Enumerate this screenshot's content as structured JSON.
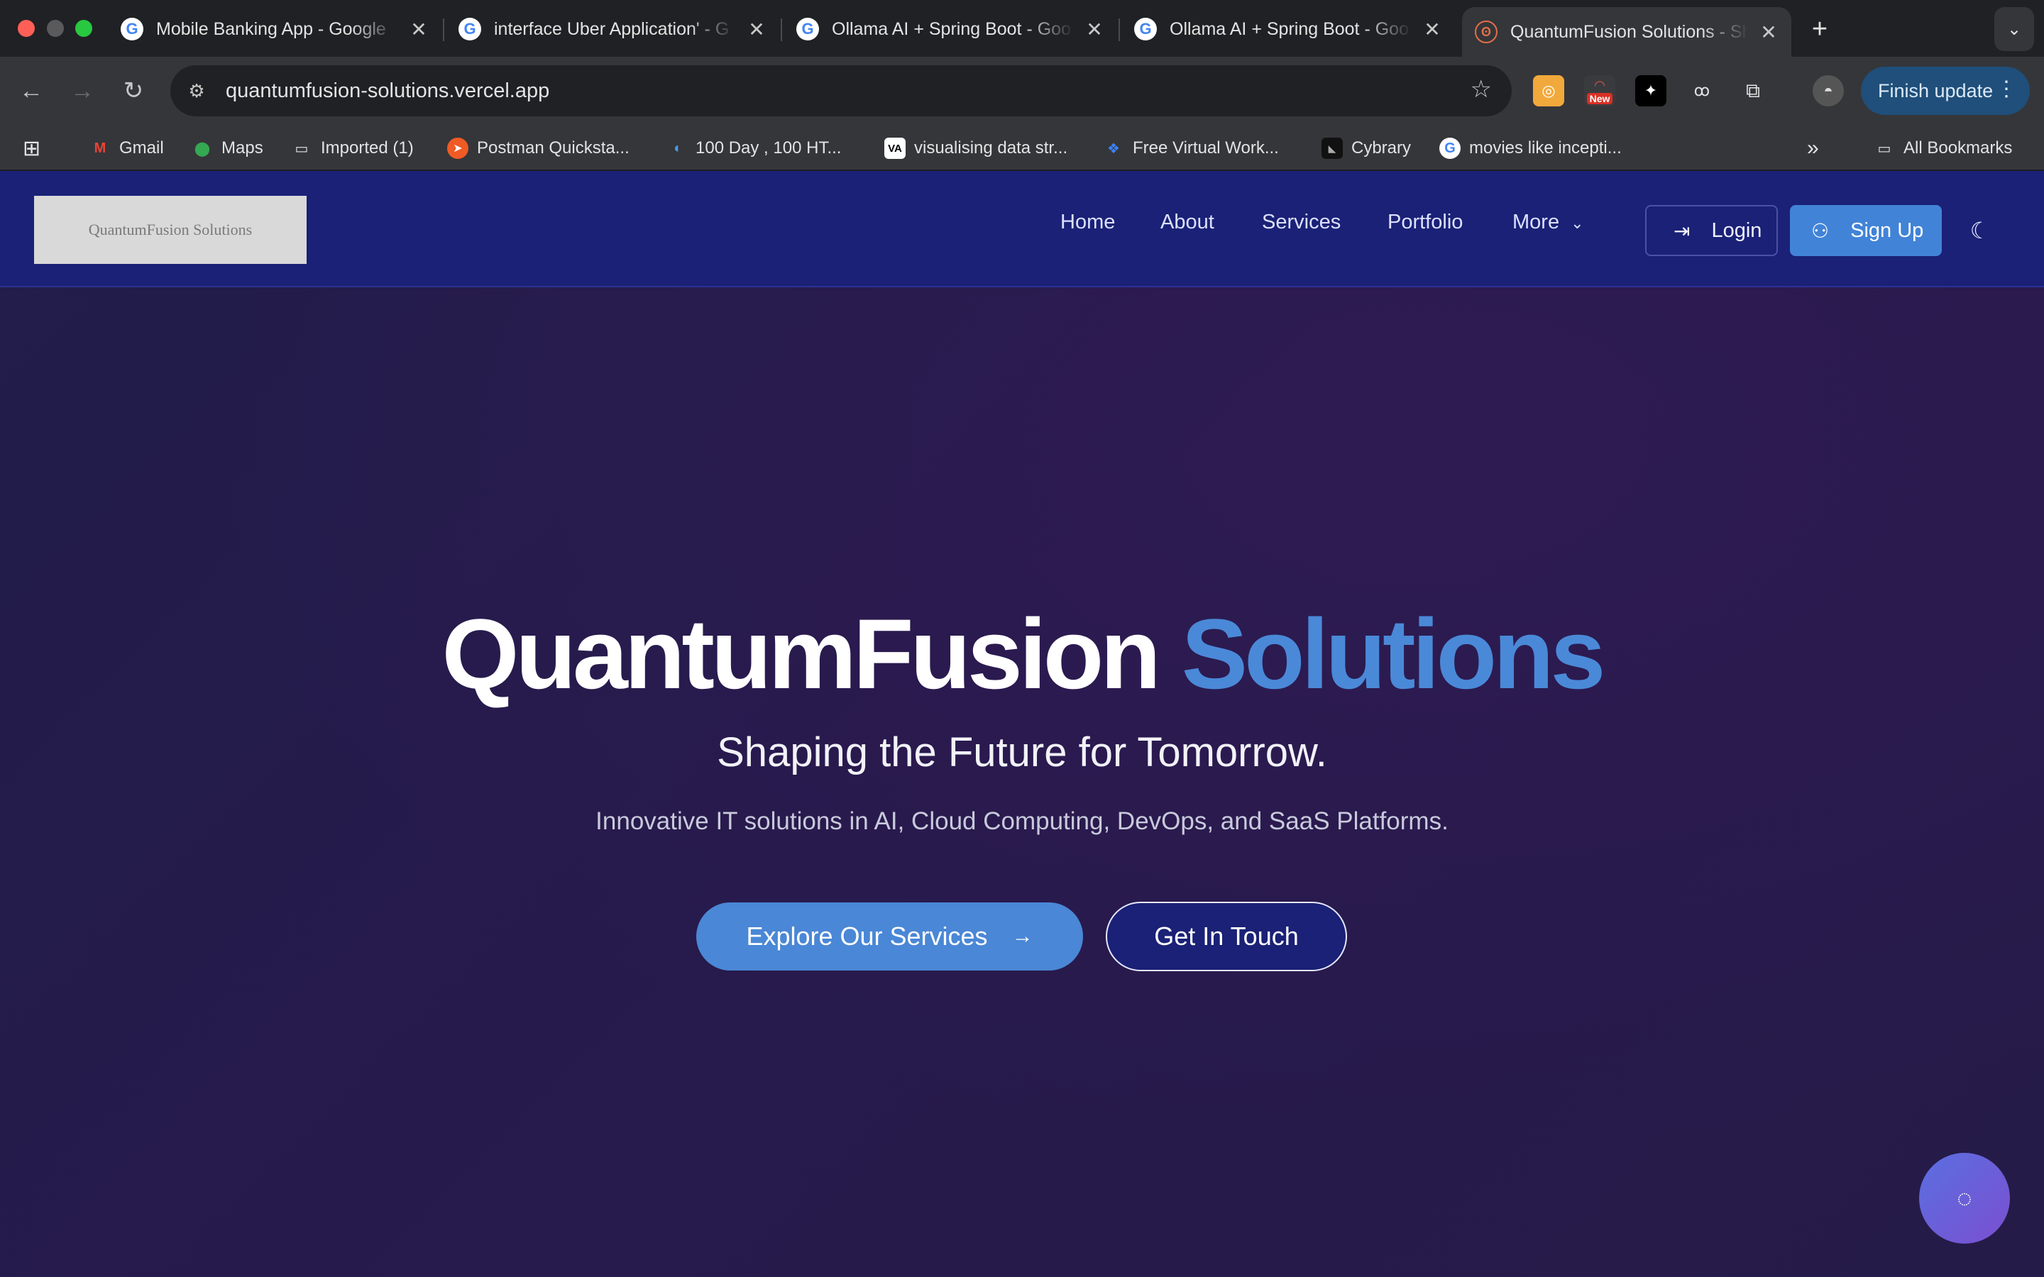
{
  "browser": {
    "tabs": [
      {
        "title": "Mobile Banking App - Google",
        "favicon": "google-icon"
      },
      {
        "title": "interface Uber Application' - G",
        "favicon": "google-icon"
      },
      {
        "title": "Ollama AI + Spring Boot - Goo",
        "favicon": "google-icon"
      },
      {
        "title": "Ollama AI + Spring Boot - Goo",
        "favicon": "google-icon"
      },
      {
        "title": "QuantumFusion Solutions - Sh",
        "favicon": "site-icon"
      }
    ],
    "new_tab_label": "+",
    "url": "quantumfusion-solutions.vercel.app",
    "ext_new_badge": "New",
    "finish_update_label": "Finish update",
    "bookmarks": [
      {
        "label": "Gmail",
        "icon": "gmail-icon"
      },
      {
        "label": "Maps",
        "icon": "maps-icon"
      },
      {
        "label": "Imported (1)",
        "icon": "folder-icon"
      },
      {
        "label": "Postman Quicksta...",
        "icon": "postman-icon"
      },
      {
        "label": "100 Day , 100 HT...",
        "icon": "headphones-icon"
      },
      {
        "label": "visualising data str...",
        "icon": "va-icon"
      },
      {
        "label": "Free Virtual Work...",
        "icon": "forage-icon"
      },
      {
        "label": "Cybrary",
        "icon": "cybrary-icon"
      },
      {
        "label": "movies like incepti...",
        "icon": "google-icon"
      }
    ],
    "all_bookmarks_label": "All Bookmarks"
  },
  "site": {
    "logo_text": "QuantumFusion Solutions",
    "nav": {
      "home": "Home",
      "about": "About",
      "services": "Services",
      "portfolio": "Portfolio",
      "more": "More"
    },
    "login_label": "Login",
    "signup_label": "Sign Up",
    "hero": {
      "title_main": "QuantumFusion",
      "title_accent": "Solutions",
      "subtitle": "Shaping the Future for Tomorrow.",
      "description": "Innovative IT solutions in AI, Cloud Computing, DevOps, and SaaS Platforms.",
      "primary_cta": "Explore Our Services",
      "secondary_cta": "Get In Touch"
    }
  },
  "colors": {
    "header_bg": "#1a2176",
    "accent": "#4a89d8",
    "hero_bg": "#241c4a"
  }
}
